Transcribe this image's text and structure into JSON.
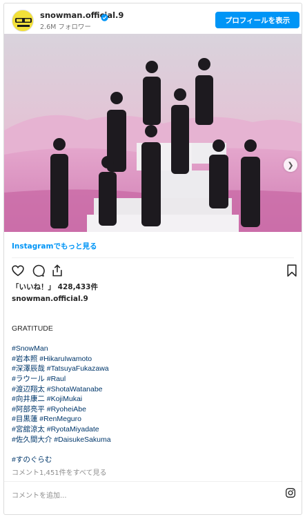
{
  "header": {
    "username": "snowman.official.9",
    "followers": "2.6M フォロワー",
    "profile_button": "プロフィールを表示"
  },
  "post": {
    "more_link": "Instagramでもっと見る",
    "likes": "「いいね！」 428,433件",
    "caption_user": "snowman.official.9",
    "caption_title": "GRATITUDE",
    "hashtags": [
      "#SnowMan",
      "#岩本照 #HikaruIwamoto",
      "#深澤辰哉 #TatsuyaFukazawa",
      "#ラウール #Raul",
      "#渡辺翔太 #ShotaWatanabe",
      "#向井康二 #KojiMukai",
      "#阿部亮平 #RyoheiAbe",
      "#目黒蓮 #RenMeguro",
      "#宮舘涼太 #RyotaMiyadate",
      "#佐久間大介 #DaisukeSakuma"
    ],
    "extra_tag": "#すのぐらむ",
    "comments_link": "コメント1,451件をすべて見る",
    "add_comment_placeholder": "コメントを追加..."
  },
  "icons": {
    "verified": "verified-badge-icon",
    "like": "heart-icon",
    "comment": "comment-icon",
    "share": "share-icon",
    "save": "bookmark-icon",
    "next": "chevron-right-icon",
    "instagram": "instagram-icon"
  },
  "colors": {
    "accent": "#0095f6",
    "hashtag": "#00376b",
    "muted": "#8e8e8e"
  }
}
